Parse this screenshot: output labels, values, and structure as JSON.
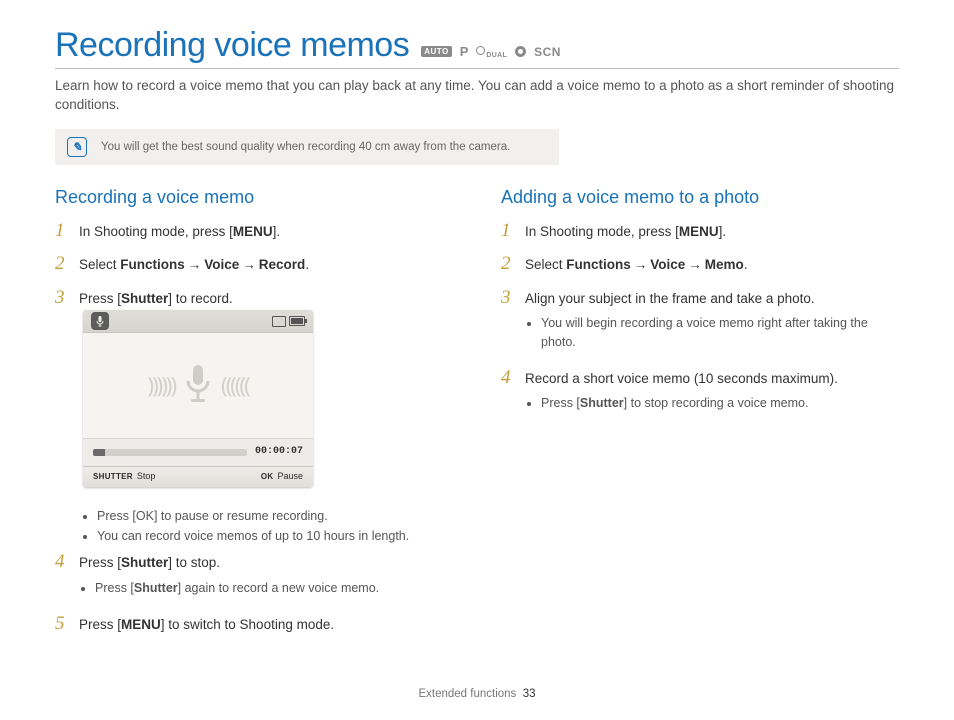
{
  "header": {
    "title": "Recording voice memos",
    "modes": {
      "auto": "AUTO",
      "p": "P",
      "dual": "DUAL",
      "scn": "SCN"
    }
  },
  "intro": "Learn how to record a voice memo that you can play back at any time. You can add a voice memo to a photo as a short reminder of shooting conditions.",
  "tip": "You will get the best sound quality when recording 40 cm away from the camera.",
  "left": {
    "title": "Recording a voice memo",
    "steps": {
      "s1a": "In Shooting mode, press [",
      "s1b": "MENU",
      "s1c": "].",
      "s2a": "Select ",
      "s2b": "Functions",
      "s2c": "Voice",
      "s2d": "Record",
      "arrow": "→",
      "s3a": "Press [",
      "s3b": "Shutter",
      "s3c": "] to record.",
      "s4a": "Press [",
      "s4b": "Shutter",
      "s4c": "] to stop.",
      "s4d": "Press [",
      "s4e": "Shutter",
      "s4f": "] again to record a new voice memo.",
      "s5a": "Press [",
      "s5b": "MENU",
      "s5c": "] to switch to Shooting mode."
    },
    "b1a": "Press [",
    "b1b": "OK",
    "b1c": "] to pause or resume recording.",
    "b2": "You can record voice memos of up to 10 hours in length."
  },
  "right": {
    "title": "Adding a voice memo to a photo",
    "steps": {
      "s1a": "In Shooting mode, press [",
      "s1b": "MENU",
      "s1c": "].",
      "s2a": "Select ",
      "s2b": "Functions",
      "s2c": "Voice",
      "s2d": "Memo",
      "arrow": "→",
      "s3": "Align your subject in the frame and take a photo.",
      "s3b": "You will begin recording a voice memo right after taking the photo.",
      "s4": "Record a short voice memo (10 seconds maximum).",
      "s4b1": "Press [",
      "s4b2": "Shutter",
      "s4b3": "] to stop recording a voice memo."
    }
  },
  "screen": {
    "time": "00:00:07",
    "shutter": "SHUTTER",
    "stop": "Stop",
    "ok": "OK",
    "pause": "Pause"
  },
  "footer": {
    "section": "Extended functions",
    "page": "33"
  },
  "nums": {
    "n1": "1",
    "n2": "2",
    "n3": "3",
    "n4": "4",
    "n5": "5"
  }
}
